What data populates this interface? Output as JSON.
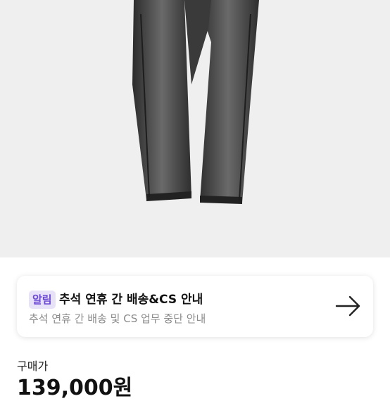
{
  "product": {
    "image_alt_icon": "jeans-photo"
  },
  "notice": {
    "badge": "알림",
    "title": "추석 연휴 간 배송&CS 안내",
    "subtitle": "추석 연휴 간 배송 및 CS 업무 중단 안내",
    "arrow_icon": "arrow-right-icon"
  },
  "price": {
    "label": "구매가",
    "value": "139,000원"
  },
  "colors": {
    "badge_bg": "#e8e2f8",
    "badge_text": "#6b48d6",
    "image_bg": "#efefef"
  }
}
